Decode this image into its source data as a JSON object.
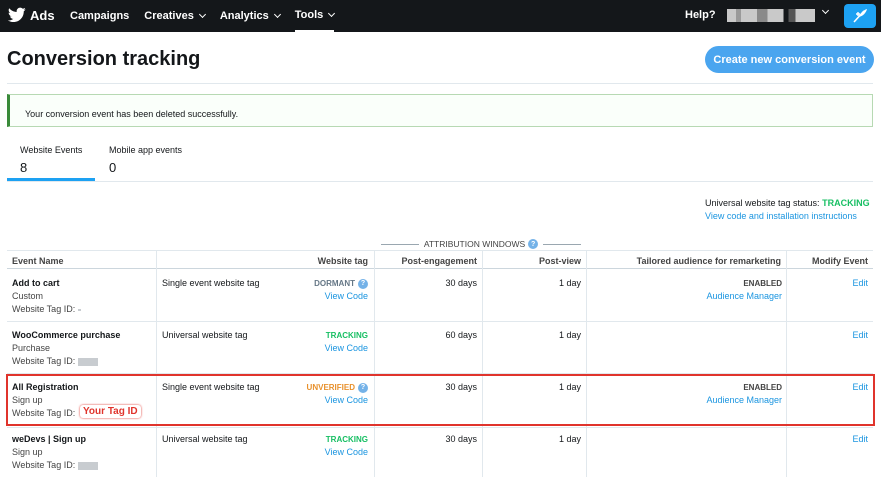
{
  "topbar": {
    "brand": "Ads",
    "nav": [
      {
        "label": "Campaigns",
        "dropdown": false
      },
      {
        "label": "Creatives",
        "dropdown": true
      },
      {
        "label": "Analytics",
        "dropdown": true
      },
      {
        "label": "Tools",
        "dropdown": true,
        "active": true
      }
    ],
    "help": "Help?"
  },
  "page": {
    "title": "Conversion tracking",
    "create_button": "Create new conversion event"
  },
  "alert": {
    "message": "Your conversion event has been deleted successfully."
  },
  "tabs": [
    {
      "label": "Website Events",
      "count": "8",
      "active": true
    },
    {
      "label": "Mobile app events",
      "count": "0",
      "active": false
    }
  ],
  "uwt": {
    "label": "Universal website tag status:",
    "status": "TRACKING",
    "link": "View code and installation instructions"
  },
  "table": {
    "group_header": "ATTRIBUTION WINDOWS",
    "columns": [
      "Event Name",
      "Website tag",
      "Post-engagement",
      "Post-view",
      "Tailored audience for remarketing",
      "Modify Event"
    ],
    "tag_id_label": "Website Tag ID:",
    "rows": [
      {
        "name": "Add to cart",
        "category": "Custom",
        "tag_type": "Single event website tag",
        "status": "DORMANT",
        "view_code": "View Code",
        "post_engagement": "30 days",
        "post_view": "1 day",
        "audience_status": "ENABLED",
        "audience_link": "Audience Manager",
        "edit": "Edit"
      },
      {
        "name": "WooCommerce purchase",
        "category": "Purchase",
        "tag_type": "Universal website tag",
        "status": "TRACKING",
        "view_code": "View Code",
        "post_engagement": "60 days",
        "post_view": "1 day",
        "audience_status": "",
        "audience_link": "",
        "edit": "Edit"
      },
      {
        "name": "All Registration",
        "category": "Sign up",
        "tag_type": "Single event website tag",
        "status": "UNVERIFIED",
        "view_code": "View Code",
        "post_engagement": "30 days",
        "post_view": "1 day",
        "audience_status": "ENABLED",
        "audience_link": "Audience Manager",
        "edit": "Edit"
      },
      {
        "name": "weDevs | Sign up",
        "category": "Sign up",
        "tag_type": "Universal website tag",
        "status": "TRACKING",
        "view_code": "View Code",
        "post_engagement": "30 days",
        "post_view": "1 day",
        "audience_status": "",
        "audience_link": "",
        "edit": "Edit"
      }
    ]
  },
  "annotation": {
    "badge": "Your Tag ID"
  },
  "colors": {
    "brand_blue": "#1da1f2",
    "tracking": "#17bf63",
    "unverified": "#e8912d",
    "highlight": "#e0342c"
  }
}
